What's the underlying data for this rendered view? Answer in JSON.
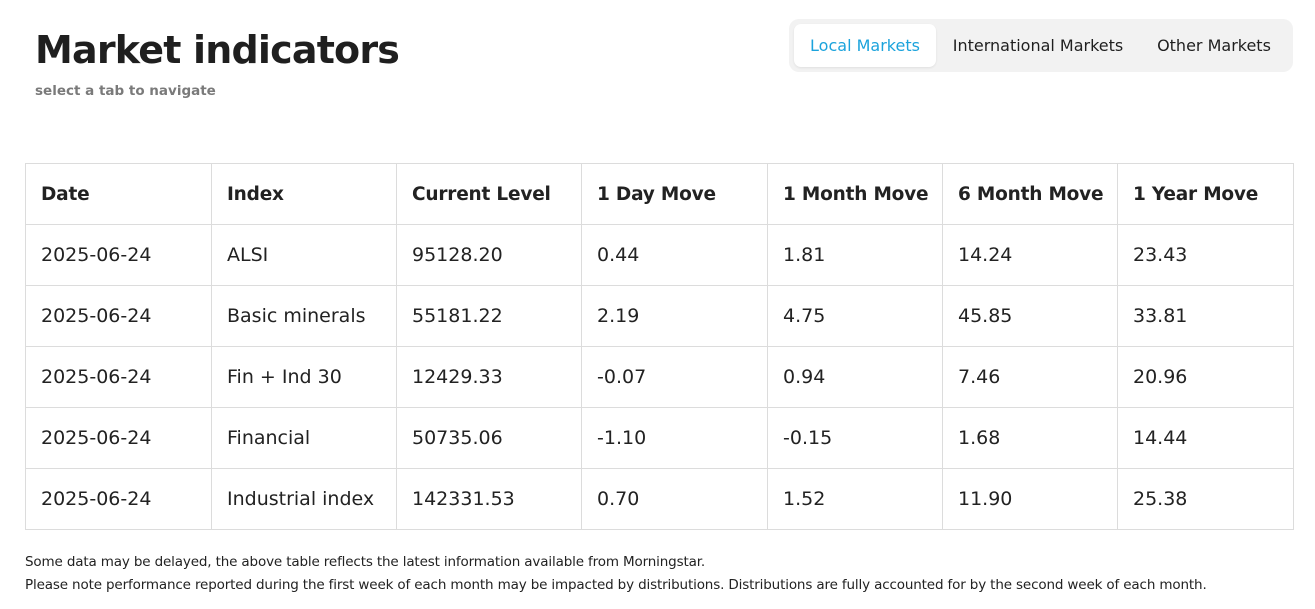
{
  "header": {
    "title": "Market indicators",
    "subtitle": "select a tab to navigate"
  },
  "tabs": [
    {
      "label": "Local Markets",
      "active": true
    },
    {
      "label": "International Markets",
      "active": false
    },
    {
      "label": "Other Markets",
      "active": false
    }
  ],
  "colors": {
    "accent": "#1ba3dc",
    "tab_bg": "#f2f2f2",
    "border": "#dcdcdc"
  },
  "table": {
    "columns": [
      "Date",
      "Index",
      "Current Level",
      "1 Day Move",
      "1 Month Move",
      "6 Month Move",
      "1 Year Move"
    ],
    "rows": [
      [
        "2025-06-24",
        "ALSI",
        "95128.20",
        "0.44",
        "1.81",
        "14.24",
        "23.43"
      ],
      [
        "2025-06-24",
        "Basic minerals",
        "55181.22",
        "2.19",
        "4.75",
        "45.85",
        "33.81"
      ],
      [
        "2025-06-24",
        "Fin + Ind 30",
        "12429.33",
        "-0.07",
        "0.94",
        "7.46",
        "20.96"
      ],
      [
        "2025-06-24",
        "Financial",
        "50735.06",
        "-1.10",
        "-0.15",
        "1.68",
        "14.44"
      ],
      [
        "2025-06-24",
        "Industrial index",
        "142331.53",
        "0.70",
        "1.52",
        "11.90",
        "25.38"
      ]
    ]
  },
  "footnotes": [
    "Some data may be delayed, the above table reflects the latest information available from Morningstar.",
    "Please note performance reported during the first week of each month may be impacted by distributions. Distributions are fully accounted for by the second week of each month."
  ]
}
